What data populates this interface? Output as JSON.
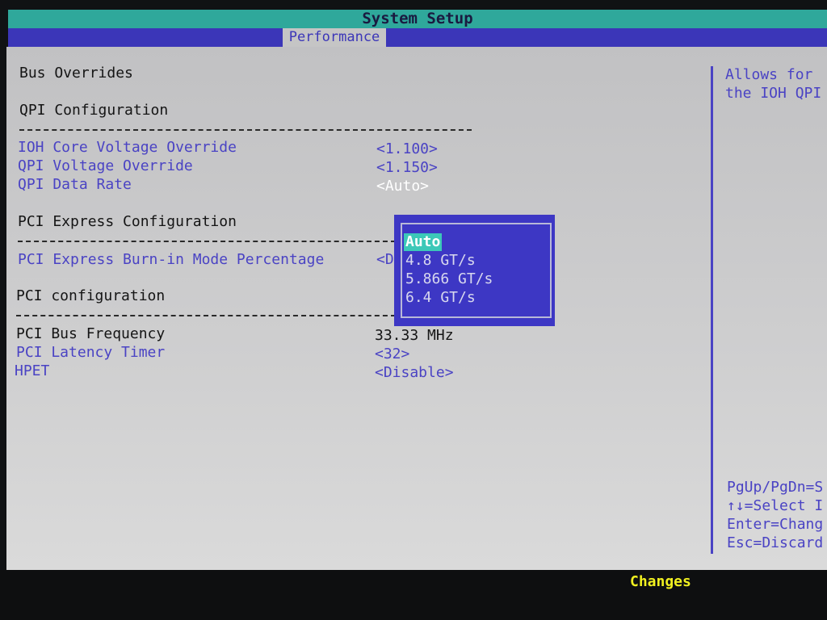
{
  "header": {
    "title": "System Setup"
  },
  "tabs": [
    {
      "label": "Performance",
      "active": true
    }
  ],
  "sections": {
    "bus_overrides": "Bus Overrides",
    "qpi_config": "QPI Configuration",
    "pcie_config": "PCI Express Configuration",
    "pci_config": "PCI configuration"
  },
  "settings": [
    {
      "label": "IOH Core Voltage Override",
      "value": "<1.100>"
    },
    {
      "label": "QPI Voltage Override",
      "value": "<1.150>"
    },
    {
      "label": "QPI Data Rate",
      "value": "<Auto>"
    },
    {
      "label": "PCI Express Burn-in Mode Percentage",
      "value": "<D"
    },
    {
      "label": "PCI Bus Frequency",
      "value": "33.33 MHz"
    },
    {
      "label": "PCI Latency Timer",
      "value": "<32>"
    },
    {
      "label": "HPET",
      "value": "<Disable>"
    }
  ],
  "popup": {
    "options": [
      "Auto",
      "4.8 GT/s",
      "5.866 GT/s",
      "6.4 GT/s"
    ],
    "selected": "Auto"
  },
  "help": {
    "line1": "Allows for",
    "line2": "the IOH QPI",
    "key1": "PgUp/PgDn=S",
    "key2": "↑↓=Select I",
    "key3": "Enter=Chang",
    "key4": "Esc=Discard"
  },
  "footer": {
    "text": "Changes"
  },
  "colors": {
    "accent": "#3b36b8",
    "title_bar": "#2fa89b",
    "highlight": "#3cc8b8",
    "footer_text": "#f0f020"
  }
}
